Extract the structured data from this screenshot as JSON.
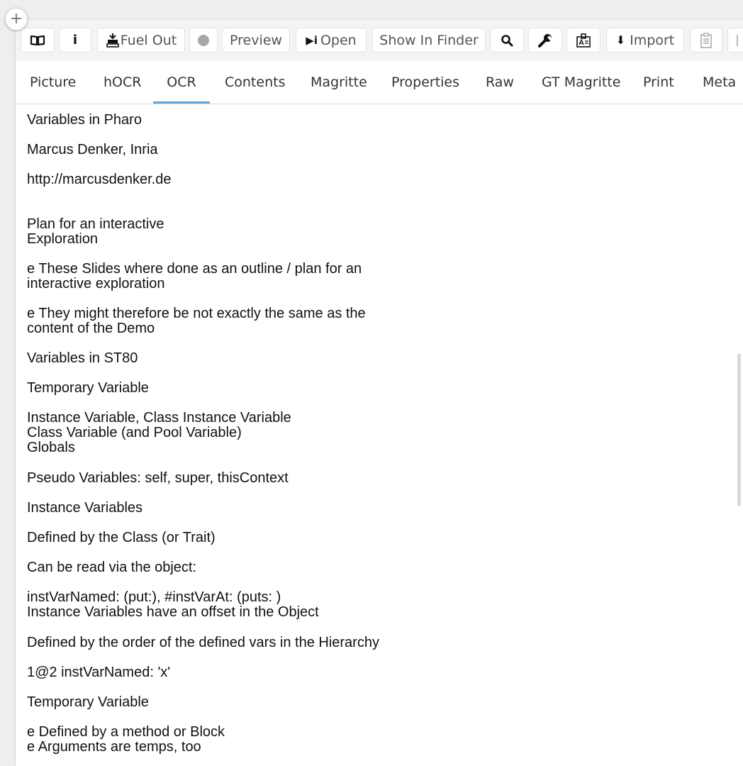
{
  "toolbar": {
    "buttons": [
      {
        "icon": "book-icon",
        "label": ""
      },
      {
        "icon": "info-icon",
        "glyph": "i",
        "label": ""
      },
      {
        "icon": "fuel-out-icon",
        "label": "Fuel Out"
      },
      {
        "icon": "record-icon",
        "label": ""
      },
      {
        "label": "Preview"
      },
      {
        "icon": "play-info-icon",
        "glyph": "▶i",
        "label": "Open"
      },
      {
        "label": "Show In Finder"
      },
      {
        "icon": "search-icon",
        "label": ""
      },
      {
        "icon": "wrench-icon",
        "label": ""
      },
      {
        "icon": "inspector-card-icon",
        "label": ""
      },
      {
        "icon": "down-arrow-icon",
        "glyph": "🡇",
        "label": "Import"
      },
      {
        "icon": "clipboard-icon",
        "label": ""
      },
      {
        "icon": "more-icon",
        "label": ""
      }
    ]
  },
  "tabs": [
    {
      "label": "Picture"
    },
    {
      "label": "hOCR"
    },
    {
      "label": "OCR",
      "active": true
    },
    {
      "label": "Contents"
    },
    {
      "label": "Magritte"
    },
    {
      "label": "Properties"
    },
    {
      "label": "Raw"
    },
    {
      "label": "GT Magritte"
    },
    {
      "label": "Print"
    },
    {
      "label": "Meta"
    }
  ],
  "ocr_paragraphs": [
    "Variables in Pharo",
    "Marcus Denker, Inria",
    "http://marcusdenker.de",
    "Plan for an interactive\nExploration",
    "e These Slides where done as an outline / plan for an\ninteractive exploration",
    "e They might therefore be not exactly the same as the\ncontent of the Demo",
    "Variables in ST80",
    "Temporary Variable",
    "Instance Variable, Class Instance Variable\nClass Variable (and Pool Variable)\nGlobals",
    "Pseudo Variables: self, super, thisContext",
    "Instance Variables",
    "Defined by the Class (or Trait)",
    "Can be read via the object:",
    "instVarNamed: (put:), #instVarAt: (puts: )\nInstance Variables have an offset in the Object",
    "Defined by the order of the defined vars in the Hierarchy",
    "1@2 instVarNamed: 'x'",
    "Temporary Variable",
    "e Defined by a method or Block\ne Arguments are temps, too"
  ],
  "colors": {
    "active_tab_underline": "#5aa7de",
    "toolbar_bg": "#f4f4f4",
    "text": "#111111"
  }
}
